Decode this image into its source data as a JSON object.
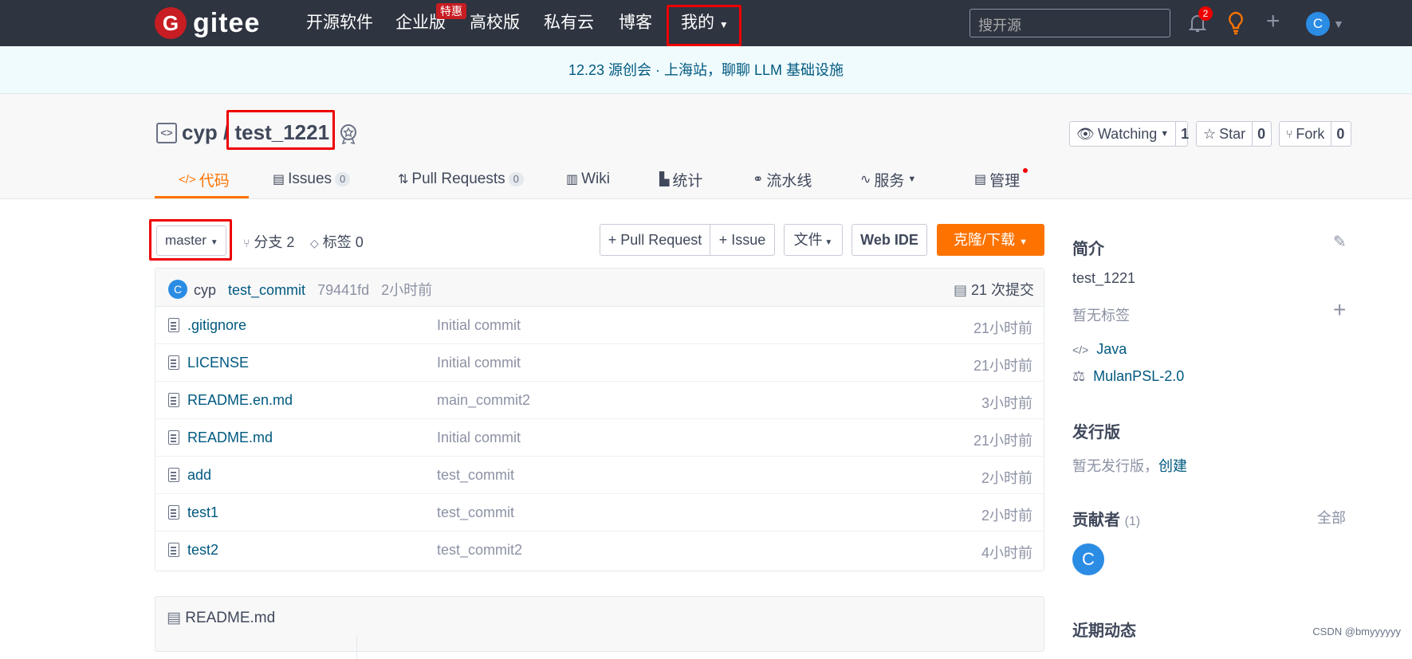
{
  "topnav": {
    "brand": "gitee",
    "brand_letter": "G",
    "items": [
      "开源软件",
      "企业版",
      "高校版",
      "私有云",
      "博客",
      "我的"
    ],
    "badge": "特惠",
    "search_placeholder": "搜开源",
    "notification_count": "2",
    "avatar_letter": "C"
  },
  "banner": {
    "text": "12.23 源创会 · 上海站，聊聊 LLM 基础设施"
  },
  "repo": {
    "owner": "cyp",
    "separator": "/",
    "name": "test_1221",
    "watching_label": "Watching",
    "watching_count": "1",
    "star_label": "Star",
    "star_count": "0",
    "fork_label": "Fork",
    "fork_count": "0"
  },
  "tabs": [
    {
      "label": "代码",
      "icon": "code-icon"
    },
    {
      "label": "Issues",
      "count": "0",
      "icon": "issues-icon"
    },
    {
      "label": "Pull Requests",
      "count": "0",
      "icon": "pull-request-icon"
    },
    {
      "label": "Wiki",
      "icon": "wiki-icon"
    },
    {
      "label": "统计",
      "icon": "stats-icon"
    },
    {
      "label": "流水线",
      "icon": "pipeline-icon"
    },
    {
      "label": "服务",
      "icon": "service-icon"
    },
    {
      "label": "管理",
      "icon": "manage-icon"
    }
  ],
  "toolbar": {
    "branch": "master",
    "branches": "分支 2",
    "tags": "标签 0",
    "pull_request": "+ Pull Request",
    "issue": "+ Issue",
    "file": "文件",
    "webide": "Web IDE",
    "clone": "克隆/下载"
  },
  "last_commit": {
    "avatar": "C",
    "author": "cyp",
    "message": "test_commit",
    "hash": "79441fd",
    "time": "2小时前",
    "total": "21 次提交"
  },
  "files": [
    {
      "name": ".gitignore",
      "message": "Initial commit",
      "time": "21小时前"
    },
    {
      "name": "LICENSE",
      "message": "Initial commit",
      "time": "21小时前"
    },
    {
      "name": "README.en.md",
      "message": "main_commit2",
      "time": "3小时前"
    },
    {
      "name": "README.md",
      "message": "Initial commit",
      "time": "21小时前"
    },
    {
      "name": "add",
      "message": "test_commit",
      "time": "2小时前"
    },
    {
      "name": "test1",
      "message": "test_commit",
      "time": "2小时前"
    },
    {
      "name": "test2",
      "message": "test_commit2",
      "time": "4小时前"
    }
  ],
  "readme": {
    "title": "README.md"
  },
  "sidebar": {
    "intro_title": "简介",
    "description": "test_1221",
    "no_tags": "暂无标签",
    "language": "Java",
    "license": "MulanPSL-2.0",
    "release_title": "发行版",
    "no_release": "暂无发行版，",
    "create": "创建",
    "contributors_title": "贡献者",
    "contributors_count": "(1)",
    "all": "全部",
    "contributor_avatar": "C",
    "recent_title": "近期动态"
  },
  "watermark": "CSDN @bmyyyyyy",
  "colors": {
    "accent": "#fe7300",
    "nav_bg": "#2e3440",
    "link": "#005980",
    "highlight": "#ee0000"
  }
}
